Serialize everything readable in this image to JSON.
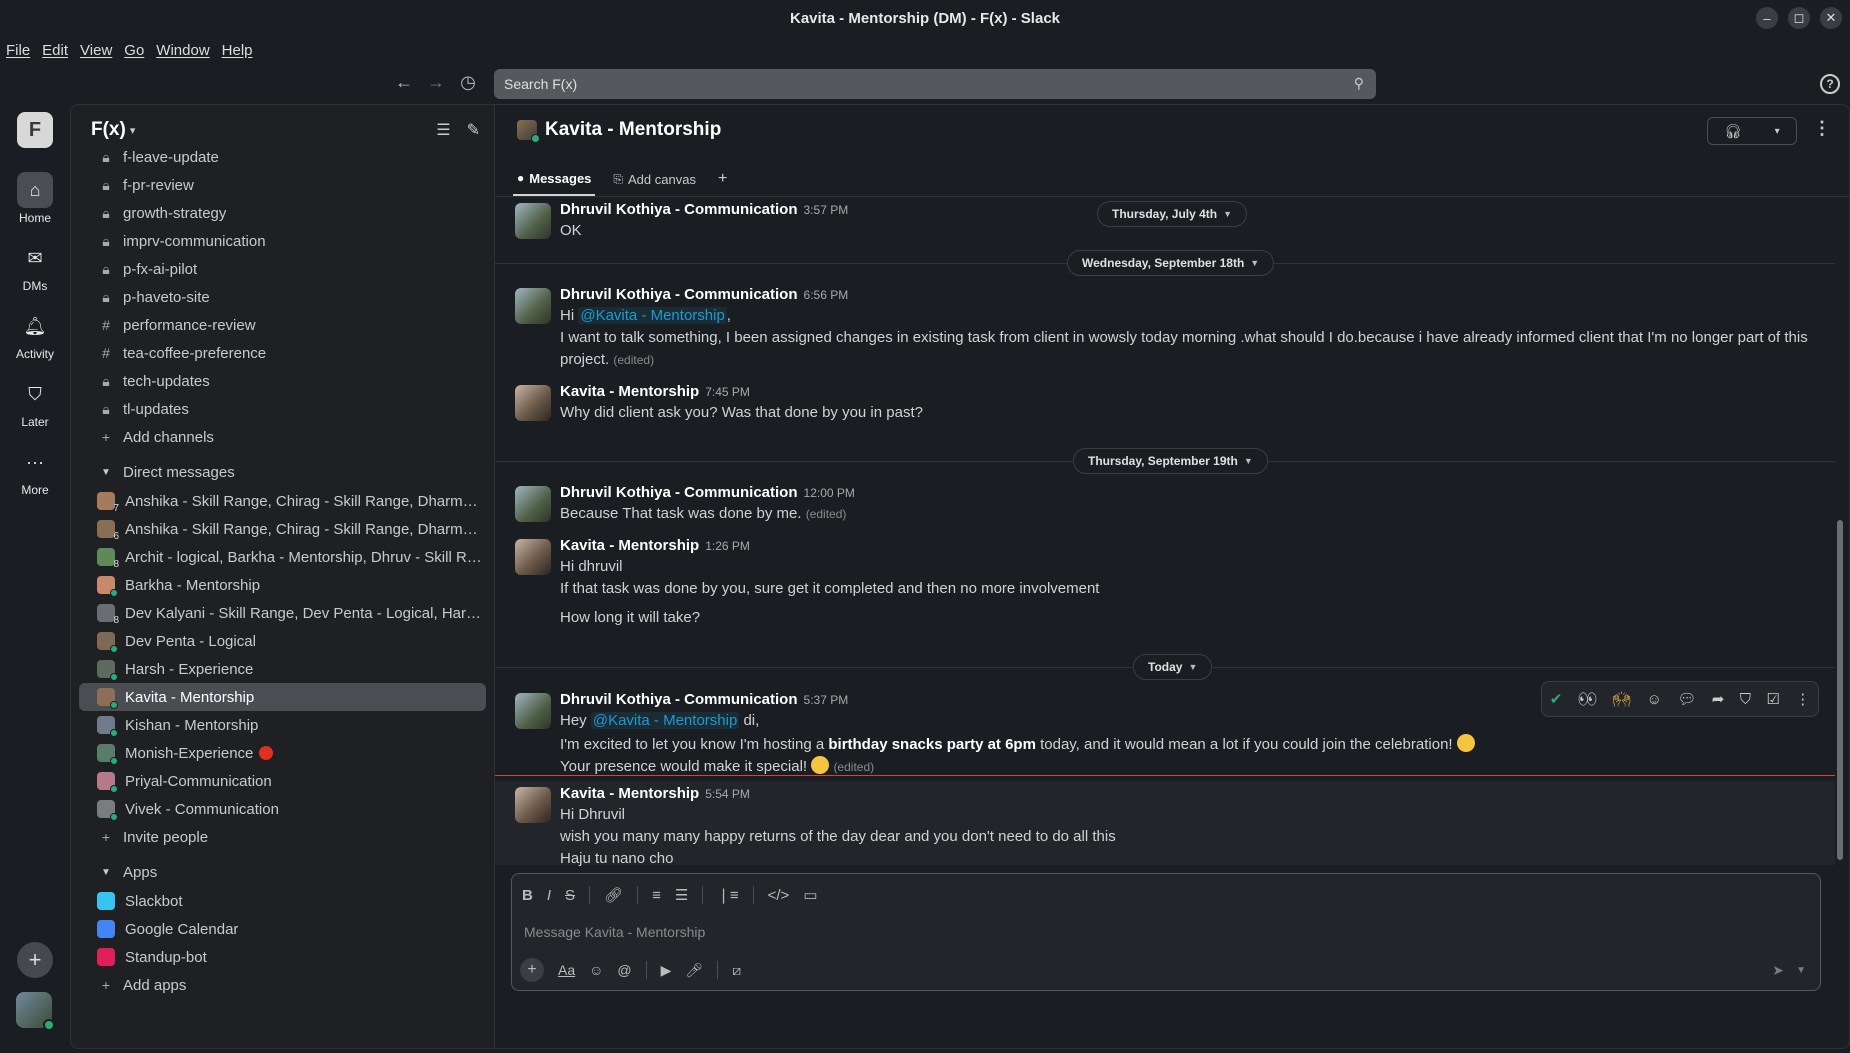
{
  "window": {
    "title": "Kavita - Mentorship (DM) - F(x) - Slack",
    "minimize": "–",
    "restore": "◻",
    "close": "✕"
  },
  "menu": [
    "File",
    "Edit",
    "View",
    "Go",
    "Window",
    "Help"
  ],
  "search": {
    "placeholder": "Search F(x)"
  },
  "rail": {
    "workspace_initial": "F",
    "items": [
      {
        "label": "Home",
        "icon": "home-icon"
      },
      {
        "label": "DMs",
        "icon": "dms-icon"
      },
      {
        "label": "Activity",
        "icon": "bell-icon"
      },
      {
        "label": "Later",
        "icon": "bookmark-icon"
      },
      {
        "label": "More",
        "icon": "more-icon"
      }
    ]
  },
  "sidebar": {
    "workspace": "F(x)",
    "channels": [
      {
        "type": "lock",
        "label": "f-leave-update"
      },
      {
        "type": "lock",
        "label": "f-pr-review"
      },
      {
        "type": "lock",
        "label": "growth-strategy"
      },
      {
        "type": "lock",
        "label": "imprv-communication"
      },
      {
        "type": "lock",
        "label": "p-fx-ai-pilot"
      },
      {
        "type": "lock",
        "label": "p-haveto-site"
      },
      {
        "type": "hash",
        "label": "performance-review"
      },
      {
        "type": "hash",
        "label": "tea-coffee-preference"
      },
      {
        "type": "lock",
        "label": "tech-updates"
      },
      {
        "type": "lock",
        "label": "tl-updates"
      }
    ],
    "add_channels": "Add channels",
    "dm_section": "Direct messages",
    "dms": [
      {
        "label": "Anshika - Skill Range, Chirag - Skill Range, Dharmesh...",
        "count": "7",
        "color": "#a57b5e"
      },
      {
        "label": "Anshika - Skill Range, Chirag - Skill Range, Dharmesh...",
        "count": "6",
        "color": "#8a6d55"
      },
      {
        "label": "Archit - logical, Barkha - Mentorship, Dhruv - Skill Ra...",
        "count": "8",
        "color": "#5e8a5a"
      },
      {
        "label": "Barkha - Mentorship",
        "count": "",
        "color": "#c68a6a"
      },
      {
        "label": "Dev Kalyani - Skill Range, Dev Penta - Logical, Harsh ...",
        "count": "8",
        "color": "#6a6d72"
      },
      {
        "label": "Dev Penta - Logical",
        "count": "",
        "color": "#7d6a55"
      },
      {
        "label": "Harsh - Experience",
        "count": "",
        "color": "#5e6a5e"
      },
      {
        "label": "Kavita - Mentorship",
        "count": "",
        "color": "#8c6f55",
        "selected": true
      },
      {
        "label": "Kishan - Mentorship",
        "count": "",
        "color": "#6f7a8a"
      },
      {
        "label": "Monish-Experience",
        "count": "",
        "color": "#5a7d6a",
        "status": "red-circle"
      },
      {
        "label": "Priyal-Communication",
        "count": "",
        "color": "#b57a8a"
      },
      {
        "label": "Vivek - Communication",
        "count": "",
        "color": "#7a7d80"
      }
    ],
    "invite": "Invite people",
    "apps_section": "Apps",
    "apps": [
      {
        "label": "Slackbot",
        "color": "#36c5f0"
      },
      {
        "label": "Google Calendar",
        "color": "#4285f4"
      },
      {
        "label": "Standup-bot",
        "color": "#e01e5a"
      }
    ],
    "add_apps": "Add apps"
  },
  "channel": {
    "name": "Kavita - Mentorship",
    "tabs": [
      {
        "label": "Messages",
        "icon": "message-icon"
      },
      {
        "label": "Add canvas",
        "icon": "canvas-icon"
      }
    ]
  },
  "date_pills": [
    "Thursday, July 4th",
    "Wednesday, September 18th",
    "Thursday, September 19th",
    "Today"
  ],
  "messages": [
    {
      "author": "Dhruvil Kothiya - Communication",
      "time": "3:57 PM",
      "text": "OK"
    },
    {
      "author": "Dhruvil Kothiya - Communication",
      "time": "6:56 PM",
      "pre": "Hi ",
      "mention": "@Kavita - Mentorship",
      "post": ",",
      "line2": "I want to talk something, I  been assigned changes  in existing task from client in wowsly today morning .what should I do.because i have already informed client that I'm no longer part of this",
      "line3": "project.",
      "edited": "(edited)"
    },
    {
      "author": "Kavita - Mentorship",
      "time": "7:45 PM",
      "text": "Why did client ask you? Was that done by you in past?"
    },
    {
      "author": "Dhruvil Kothiya - Communication",
      "time": "12:00 PM",
      "text": "Because That task was done by me.",
      "edited": "(edited)"
    },
    {
      "author": "Kavita - Mentorship",
      "time": "1:26 PM",
      "text": "Hi dhruvil",
      "line2": "If that task was done by you, sure get it completed and then no more involvement",
      "line3": "How long it will take?"
    },
    {
      "author": "Dhruvil Kothiya - Communication",
      "time": "5:37 PM",
      "pre": "Hey ",
      "mention": "@Kavita - Mentorship",
      "post": " di,",
      "line2a": "I'm excited to let you know I'm hosting a ",
      "line2b": "birthday snacks party at 6pm",
      "line2c": " today, and it would mean a lot if you could join the celebration!",
      "line3": "Your presence would make it special!",
      "edited": "(edited)"
    },
    {
      "author": "Kavita - Mentorship",
      "time": "5:54 PM",
      "text": "Hi Dhruvil",
      "line2": "wish you many many happy returns of the day dear and you don't need to do all this",
      "line3": "Haju tu nano cho"
    }
  ],
  "composer": {
    "placeholder": "Message Kavita - Mentorship"
  },
  "colors": {
    "accent_link": "#1d9bd1",
    "online": "#2bac76",
    "new_line": "#c94a3a"
  }
}
